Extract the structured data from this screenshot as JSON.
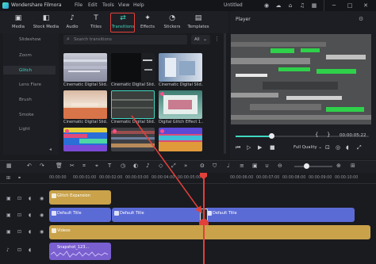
{
  "app": {
    "name": "Wondershare Filmora",
    "menu": [
      "File",
      "Edit",
      "Tools",
      "View",
      "Help"
    ],
    "project_title": "Untitled"
  },
  "toolbar": {
    "items": [
      {
        "label": "Media",
        "icon": "media-folder-icon"
      },
      {
        "label": "Stock Media",
        "icon": "stock-media-icon"
      },
      {
        "label": "Audio",
        "icon": "music-note-icon"
      },
      {
        "label": "Titles",
        "icon": "text-t-icon"
      },
      {
        "label": "Transitions",
        "icon": "transition-icon"
      },
      {
        "label": "Effects",
        "icon": "effects-icon"
      },
      {
        "label": "Stickers",
        "icon": "sticker-icon"
      },
      {
        "label": "Templates",
        "icon": "template-icon"
      }
    ],
    "active": "Transitions"
  },
  "categories": [
    "Slideshow",
    "Zoom",
    "Glitch",
    "Lens Flare",
    "Brush",
    "Smoke",
    "Light"
  ],
  "active_category": "Glitch",
  "search": {
    "placeholder": "Search transitions"
  },
  "filter": {
    "value": "All"
  },
  "transitions": [
    {
      "label": "Cinematic Digital Slid..."
    },
    {
      "label": "Cinematic Digital Slid..."
    },
    {
      "label": "Cinematic Digital Slid..."
    },
    {
      "label": "Cinematic Digital Slid..."
    },
    {
      "label": "Cinematic Digital Slid..."
    },
    {
      "label": "Digital Glitch Effect 1..."
    },
    {
      "label": ""
    },
    {
      "label": ""
    },
    {
      "label": ""
    }
  ],
  "player": {
    "title": "Player",
    "timecode": "00:00:05:22",
    "quality": "Full Quality",
    "progress": 0.27
  },
  "ruler": {
    "ticks": [
      "00:00:00",
      "00:00:01:00",
      "00:00:02:00",
      "00:00:03:00",
      "00:00:04:00",
      "00:00:05:00",
      "00:00:06:00",
      "00:00:07:00",
      "00:00:08:00",
      "00:00:09:00",
      "00:00:10:00",
      "00:00:11:00"
    ]
  },
  "timeline": {
    "clips": {
      "title_top": "Glitch Expansion",
      "default_title_1": "Default Title",
      "default_title_2": "Default Title",
      "default_title_3": "Default Title",
      "video": "Videos",
      "audio": "Snapshot_123..."
    }
  },
  "colors": {
    "accent": "#3fd7c0",
    "highlight_red": "#e2403a",
    "title_clip": "#5b6bd6",
    "video_clip": "#c9a24a",
    "audio_clip": "#7a5fd0"
  }
}
